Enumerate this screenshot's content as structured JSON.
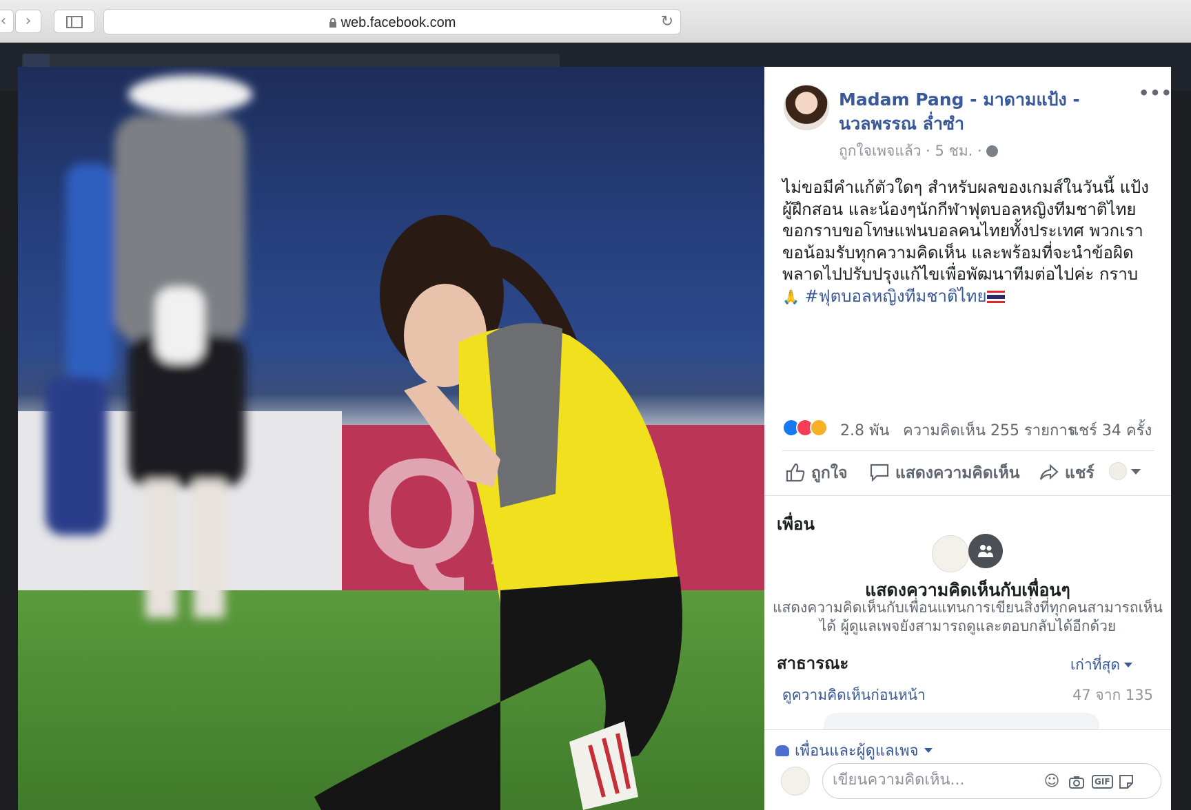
{
  "browser": {
    "url": "web.facebook.com",
    "back_label": "‹",
    "forward_label": "›",
    "reload_label": "↻"
  },
  "post": {
    "page_name": "Madam Pang - มาดามแป้ง - นวลพรรณ ล่ำซำ",
    "meta": "ถูกใจเพจแล้ว · 5 ชม. ·",
    "more_label": "•••",
    "text": "ไม่ขอมีคำแก้ตัวใดๆ สำหรับผลของเกมส์ในวันนี้ แป้ง ผู้ฝึกสอน และน้องๆนักกีฬาฟุตบอลหญิงทีมชาติไทย ขอกราบขอโทษแฟนบอลคนไทยทั้งประเทศ พวกเราขอน้อมรับทุกความคิดเห็น และพร้อมที่จะนำข้อผิดพลาดไปปรับปรุงแก้ไขเพื่อพัฒนาทีมต่อไปค่ะ กราบ",
    "pray_emoji": "🙏",
    "hashtag": "#ฟุตบอลหญิงทีมชาติไทย",
    "reaction_count": "2.8 พัน",
    "comment_count": "ความคิดเห็น 255 รายการ",
    "share_count": "แชร์ 34 ครั้ง",
    "reactions": [
      "like-icon",
      "love-icon",
      "sad-icon"
    ]
  },
  "actions": {
    "like": "ถูกใจ",
    "comment": "แสดงความคิดเห็น",
    "share": "แชร์"
  },
  "friends": {
    "title": "เพื่อน",
    "promo_title": "แสดงความคิดเห็นกับเพื่อนๆ",
    "promo_body": "แสดงความคิดเห็นกับเพื่อนแทนการเขียนสิ่งที่ทุกคนสามารถเห็นได้ ผู้ดูแลเพจยังสามารถดูและตอบกลับได้อีกด้วย"
  },
  "public": {
    "title": "สาธารณะ",
    "sort_label": "เก่าที่สุด",
    "prev_comments": "ดูความคิดเห็นก่อนหน้า",
    "pager": "47 จาก 135"
  },
  "composer": {
    "audience": "เพื่อนและผู้ดูแลเพจ",
    "placeholder": "เขียนความคิดเห็น...",
    "gif_label": "GIF"
  },
  "colors": {
    "link": "#385898",
    "like": "#1877f2",
    "love": "#f33e58",
    "sad": "#f7b125"
  }
}
